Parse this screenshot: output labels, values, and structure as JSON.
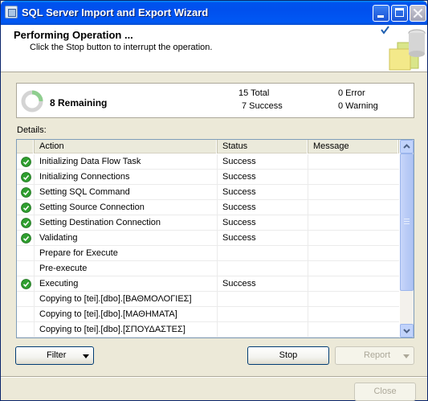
{
  "window": {
    "title": "SQL Server Import and Export Wizard"
  },
  "header": {
    "title": "Performing Operation ...",
    "subtitle": "Click the Stop button to interrupt the operation."
  },
  "summary": {
    "remaining": "8 Remaining",
    "total": "15 Total",
    "success": "7 Success",
    "error": "0 Error",
    "warning": "0 Warning"
  },
  "details_label": "Details:",
  "table": {
    "headers": {
      "action": "Action",
      "status": "Status",
      "message": "Message"
    },
    "rows": [
      {
        "icon": "success-icon",
        "action": "Initializing Data Flow Task",
        "status": "Success",
        "message": ""
      },
      {
        "icon": "success-icon",
        "action": "Initializing Connections",
        "status": "Success",
        "message": ""
      },
      {
        "icon": "success-icon",
        "action": "Setting SQL Command",
        "status": "Success",
        "message": ""
      },
      {
        "icon": "success-icon",
        "action": "Setting Source Connection",
        "status": "Success",
        "message": ""
      },
      {
        "icon": "success-icon",
        "action": "Setting Destination Connection",
        "status": "Success",
        "message": ""
      },
      {
        "icon": "success-icon",
        "action": "Validating",
        "status": "Success",
        "message": ""
      },
      {
        "icon": "",
        "action": "Prepare for Execute",
        "status": "",
        "message": ""
      },
      {
        "icon": "",
        "action": "Pre-execute",
        "status": "",
        "message": ""
      },
      {
        "icon": "success-icon",
        "action": "Executing",
        "status": "Success",
        "message": ""
      },
      {
        "icon": "",
        "action": "Copying to [tei].[dbo].[ΒΑΘΜΟΛΟΓΙΕΣ]",
        "status": "",
        "message": ""
      },
      {
        "icon": "",
        "action": "Copying to [tei].[dbo].[ΜΑΘΗΜΑΤΑ]",
        "status": "",
        "message": ""
      },
      {
        "icon": "",
        "action": "Copying to [tei].[dbo].[ΣΠΟΥΔΑΣΤΕΣ]",
        "status": "",
        "message": ""
      }
    ]
  },
  "buttons": {
    "filter": "Filter",
    "stop": "Stop",
    "report": "Report",
    "close": "Close"
  },
  "colors": {
    "titlebar": "#0054e3",
    "success_green": "#2f9e2f",
    "window_bg": "#ece9d8"
  }
}
